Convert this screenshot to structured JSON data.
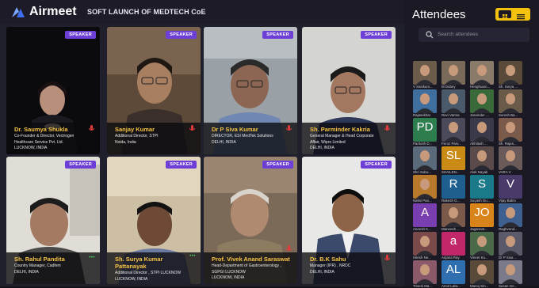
{
  "brand": {
    "name": "Airmeet"
  },
  "event": {
    "title": "SOFT LAUNCH OF MEDTECH CoE"
  },
  "speaker_badge": "SPEAKER",
  "speakers": [
    {
      "name": "Dr. Saumya Shukla",
      "line1": "Co-Founder & Director, Vectrogen",
      "line2": "Healthcare Service Pvt. Ltd.",
      "line3": "LUCKNOW, INDIA"
    },
    {
      "name": "Sanjay Kumar",
      "line1": "Additional Director, STPI",
      "line2": "Noida, India",
      "line3": ""
    },
    {
      "name": "Dr P Siva Kumar",
      "line1": "DIRECTOR, ESI MedTek Solutions",
      "line2": "DELHI, INDIA",
      "line3": ""
    },
    {
      "name": "Sh. Parminder Kakria",
      "line1": "General Manager & Head Corporate",
      "line2": "Affair, Wipro Limited",
      "line3": "DELHI, INDIA"
    },
    {
      "name": "Sh. Rahul Pandita",
      "line1": "Country Manager, Cadfem",
      "line2": "DELHI, INDIA",
      "line3": ""
    },
    {
      "name": "Sh. Surya Kumar Pattanayak",
      "line1": "Additional Director , STPI LUCKNOW",
      "line2": "LUCKNOW, INDIA",
      "line3": ""
    },
    {
      "name": "Prof. Vivek Anand Saraswat",
      "line1": "Head-Department of Gastroenterology ,",
      "line2": "SGPGI LUCKNOW",
      "line3": "LUCKNOW, INDIA"
    },
    {
      "name": "Dr. B.K Sahu",
      "line1": "Manager (IPR) , NRDC",
      "line2": "DELHI, INDIA",
      "line3": ""
    }
  ],
  "sidebar": {
    "title": "Attendees",
    "search_placeholder": "Search attendees",
    "attendees": [
      {
        "name": "V Sasikum...",
        "initials": "",
        "color": "#6b5b4a"
      },
      {
        "name": "M Dubey",
        "initials": "",
        "color": "#7a6a5a"
      },
      {
        "name": "Henghuam...",
        "initials": "",
        "color": "#8a7a6a"
      },
      {
        "name": "Sh. Surya ...",
        "initials": "",
        "color": "#5a4a3a"
      },
      {
        "name": "Rajasekhar",
        "initials": "",
        "color": "#3f6f9f"
      },
      {
        "name": "Ravi Varma",
        "initials": "",
        "color": "#4a5a6a"
      },
      {
        "name": "Jasvinder ...",
        "initials": "",
        "color": "#3a6a3a"
      },
      {
        "name": "Suresh Ba...",
        "initials": "",
        "color": "#6a5a4a"
      },
      {
        "name": "Paritosh D...",
        "initials": "PD",
        "color": "#2e7d4f"
      },
      {
        "name": "Feroz Parv...",
        "initials": "",
        "color": "#4a4a5a"
      },
      {
        "name": "Abhilash ...",
        "initials": "",
        "color": "#3a3a4a"
      },
      {
        "name": "Sh. Rajes...",
        "initials": "",
        "color": "#7a5a4a"
      },
      {
        "name": "Shri Subo...",
        "initials": "",
        "color": "#5a6a7a"
      },
      {
        "name": "SHAILEN...",
        "initials": "SL",
        "color": "#c98a16"
      },
      {
        "name": "Alok Nayak",
        "initials": "",
        "color": "#5a4a4a"
      },
      {
        "name": "VARA V",
        "initials": "",
        "color": "#6a5a5a"
      },
      {
        "name": "Nalini Pan...",
        "initials": "",
        "color": "#b9792a"
      },
      {
        "name": "Rakesh G...",
        "initials": "R",
        "color": "#1f5f8f"
      },
      {
        "name": "Suyash Gu...",
        "initials": "S",
        "color": "#1a7a8a"
      },
      {
        "name": "Vijay Balmi",
        "initials": "V",
        "color": "#4a3a6a"
      },
      {
        "name": "Aneesh K...",
        "initials": "A",
        "color": "#7a3fae"
      },
      {
        "name": "Maneesh ...",
        "initials": "",
        "color": "#7a5a4a"
      },
      {
        "name": "Jagannat...",
        "initials": "JO",
        "color": "#d9841a"
      },
      {
        "name": "Raghvend...",
        "initials": "",
        "color": "#3f5f8f"
      },
      {
        "name": "Hitesh Ne...",
        "initials": "",
        "color": "#7a4a4a"
      },
      {
        "name": "Anjana Ray",
        "initials": "a",
        "color": "#c0286a"
      },
      {
        "name": "Vineet Ku...",
        "initials": "",
        "color": "#4a6a4a"
      },
      {
        "name": "Dr P Siva ...",
        "initials": "",
        "color": "#5a5a6a"
      },
      {
        "name": "Triveni Ma...",
        "initials": "",
        "color": "#8a5a6a"
      },
      {
        "name": "Amol Lalw...",
        "initials": "AL",
        "color": "#2f6fb0"
      },
      {
        "name": "Manoj Sin...",
        "initials": "",
        "color": "#5a4a3a"
      },
      {
        "name": "Susan Ge...",
        "initials": "",
        "color": "#7a7a8a"
      }
    ]
  },
  "colors": {
    "accent": "#6e3fd6",
    "name_text": "#f6c343",
    "toggle": "#f4c20d",
    "mic_red": "#e23b3b",
    "active_green": "#4cd964"
  }
}
